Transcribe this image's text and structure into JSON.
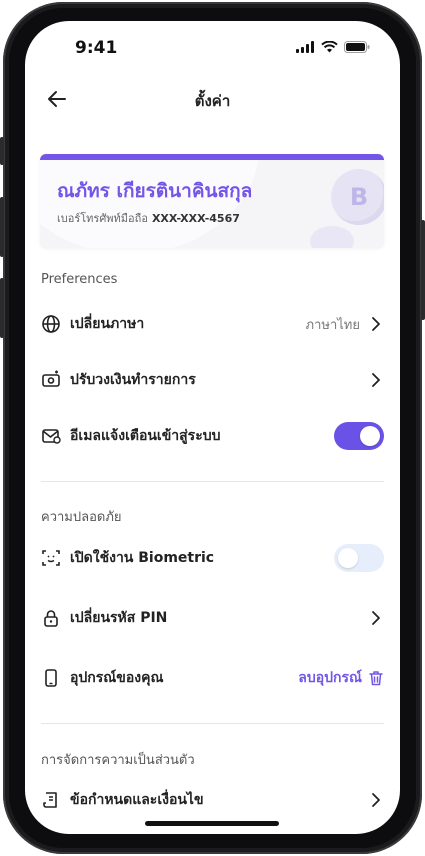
{
  "status_bar": {
    "time": "9:41"
  },
  "header": {
    "title": "ตั้งค่า"
  },
  "profile": {
    "name": "ณภัทร เกียรตินาคินสกุล",
    "phone_label": "เบอร์โทรศัพท์มือถือ",
    "phone_value": "XXX-XXX-4567",
    "coin_symbol": "B"
  },
  "sections": {
    "preferences": {
      "title": "Preferences",
      "language": {
        "label": "เปลี่ยนภาษา",
        "value": "ภาษาไทย"
      },
      "limit": {
        "label": "ปรับวงเงินทำรายการ"
      },
      "email_alert": {
        "label": "อีเมลแจ้งเตือนเข้าสู่ระบบ",
        "enabled": true
      }
    },
    "security": {
      "title": "ความปลอดภัย",
      "biometric": {
        "label": "เปิดใช้งาน Biometric",
        "enabled": false
      },
      "pin": {
        "label": "เปลี่ยนรหัส PIN"
      },
      "device": {
        "label": "อุปกรณ์ของคุณ",
        "action": "ลบอุปกรณ์"
      }
    },
    "privacy": {
      "title": "การจัดการความเป็นส่วนตัว",
      "terms": {
        "label": "ข้อกำหนดและเงื่อนไข"
      }
    }
  },
  "colors": {
    "accent": "#6b52e6",
    "brand_text": "#7356e8",
    "toggle_off": "#e7eefb"
  }
}
